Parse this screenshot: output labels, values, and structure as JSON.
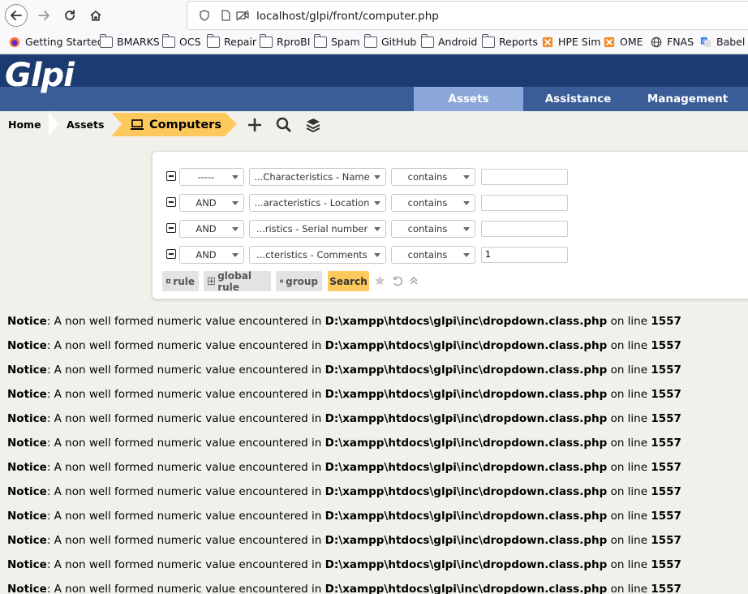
{
  "browser": {
    "url": "localhost/glpi/front/computer.php",
    "bookmarks": [
      {
        "label": "Getting Started",
        "icon": "firefox-icon"
      },
      {
        "label": "BMARKS",
        "icon": "folder-icon"
      },
      {
        "label": "OCS",
        "icon": "folder-icon"
      },
      {
        "label": "Repair",
        "icon": "folder-icon"
      },
      {
        "label": "RproBI",
        "icon": "folder-icon"
      },
      {
        "label": "Spam",
        "icon": "folder-icon"
      },
      {
        "label": "GitHub",
        "icon": "folder-icon"
      },
      {
        "label": "Android",
        "icon": "folder-icon"
      },
      {
        "label": "Reports",
        "icon": "folder-icon"
      },
      {
        "label": "HPE Sim",
        "icon": "hpe-icon"
      },
      {
        "label": "OME",
        "icon": "hpe-icon"
      },
      {
        "label": "FNAS",
        "icon": "globe-icon"
      },
      {
        "label": "Babel",
        "icon": "translate-icon"
      }
    ]
  },
  "header": {
    "logo": "Glpi",
    "menu": [
      "Assets",
      "Assistance",
      "Management"
    ]
  },
  "breadcrumb": {
    "home": "Home",
    "assets": "Assets",
    "current": "Computers"
  },
  "search": {
    "rows": [
      {
        "logic": "-----",
        "field": "...Characteristics - Name",
        "operator": "contains",
        "value": ""
      },
      {
        "logic": "AND",
        "field": "...aracteristics - Location",
        "operator": "contains",
        "value": ""
      },
      {
        "logic": "AND",
        "field": "...ristics - Serial number",
        "operator": "contains",
        "value": ""
      },
      {
        "logic": "AND",
        "field": "...cteristics - Comments",
        "operator": "contains",
        "value": "1"
      }
    ],
    "buttons": {
      "rule": "rule",
      "global_rule": "global rule",
      "group": "group",
      "search": "Search"
    }
  },
  "notices": {
    "label": "Notice",
    "message": ": A non well formed numeric value encountered in ",
    "path": "D:\\xampp\\htdocs\\glpi\\inc\\dropdown.class.php",
    "on_line": " on line ",
    "line": "1557",
    "count": 12
  },
  "colors": {
    "header_dark": "#1c3b71",
    "header_band": "#3a5d98",
    "menu_active": "#8ba6d8",
    "accent_yellow": "#fec95c",
    "page_bg": "#f1f0eb"
  }
}
